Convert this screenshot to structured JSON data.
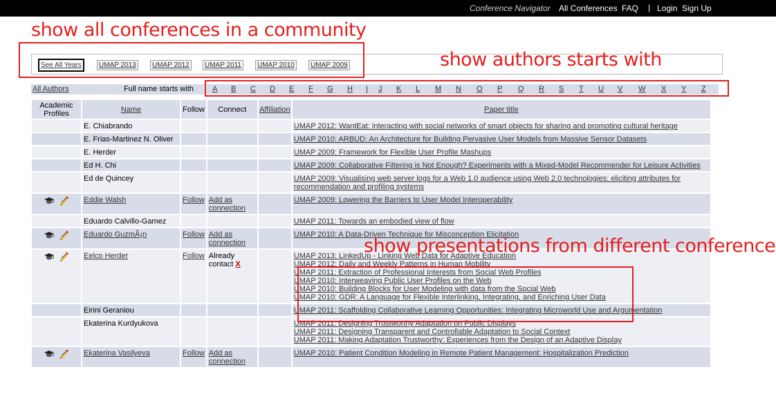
{
  "topbar": {
    "brand": "Conference Navigator",
    "all_conferences": "All Conferences",
    "faq": "FAQ",
    "separator": "|",
    "login": "Login",
    "signup": "Sign Up"
  },
  "year_filter": {
    "items": [
      "See All Years",
      "UMAP 2013",
      "UMAP 2012",
      "UMAP 2011",
      "UMAP 2010",
      "UMAP 2009"
    ]
  },
  "letter_filter": {
    "all_authors": "All Authors",
    "label": "Full name starts with",
    "letters": [
      "A",
      "B",
      "C",
      "D",
      "E",
      "F",
      "G",
      "H",
      "I",
      "J",
      "K",
      "L",
      "M",
      "N",
      "O",
      "P",
      "Q",
      "R",
      "S",
      "T",
      "U",
      "V",
      "W",
      "X",
      "Y",
      "Z"
    ]
  },
  "table": {
    "headers": {
      "profiles": "Academic Profiles",
      "name": "Name",
      "follow": "Follow",
      "connect": "Connect",
      "affiliation": "Affiliation",
      "paper": "Paper title"
    },
    "rows": [
      {
        "name": "E. Chiabrando",
        "papers": [
          "UMAP 2012: WantEat: interacting with social networks of smart objects for sharing and promoting cultural heritage"
        ]
      },
      {
        "name": "E. Frias-Martinez N. Oliver",
        "papers": [
          "UMAP 2010: ARBUD: An Architecture for Building Pervasive User Models from Massive Sensor Datasets"
        ]
      },
      {
        "name": "E. Herder",
        "papers": [
          "UMAP 2009: Framework for Flexible User Profile Mashups"
        ]
      },
      {
        "name": "Ed H. Chi",
        "papers": [
          "UMAP 2009: Collaborative Filtering is Not Enough? Experiments with a Mixed-Model Recommender for Leisure Activities"
        ]
      },
      {
        "name": "Ed de Quincey",
        "papers": [
          "UMAP 2009: Visualising web server logs for a Web 1.0 audience using Web 2.0 technologies: eliciting attributes for recommendation and profiling systems"
        ]
      },
      {
        "name": "Eddie Walsh",
        "follow": "Follow",
        "connect": "Add as connection",
        "papers": [
          "UMAP 2009: Lowering the Barriers to User Model Interoperability"
        ]
      },
      {
        "name": "Eduardo Calvillo-Gamez",
        "papers": [
          "UMAP 2011: Towards an embodied view of flow"
        ]
      },
      {
        "name": "Eduardo GuzmÃ¡n",
        "follow": "Follow",
        "connect": "Add as connection",
        "papers": [
          "UMAP 2010: A Data-Driven Technique for Misconception Elicitation"
        ]
      },
      {
        "name": "Eelco Herder",
        "follow": "Follow",
        "connect": "Already contact",
        "connect_x": "X",
        "papers": [
          "UMAP 2013: LinkedUp - Linking Web Data for Adaptive Education",
          "UMAP 2012: Daily and Weekly Patterns in Human Mobility",
          "UMAP 2011: Extraction of Professional Interests from Social Web Profiles",
          "UMAP 2010: Interweaving Public User Profiles on the Web",
          "UMAP 2010: Building Blocks for User Modeling with data from the Social Web",
          "UMAP 2010: GDR: A Language for Flexible Interlinking, Integrating, and Enriching User Data"
        ]
      },
      {
        "name": "Eirini Geraniou",
        "papers": [
          "UMAP 2011: Scaffolding Collaborative Learning Opportunities: Integrating Microworld Use and Argumentation"
        ]
      },
      {
        "name": "Ekaterina Kurdyukova",
        "papers": [
          "UMAP 2011: Designing Trustworthy Adaptation on Public Displays",
          "UMAP 2011: Designing Transparent and Controllable Adaptation to Social Context",
          "UMAP 2011: Making Adaptation Trustworthy: Experiences from the Design of an Adaptive Display"
        ]
      },
      {
        "name": "Ekaterina Vasilyeva",
        "follow": "Follow",
        "connect": "Add as connection",
        "papers": [
          "UMAP 2010: Patient Condition Modeling in Remote Patient Management: Hospitalization Prediction"
        ]
      }
    ]
  },
  "annotations": {
    "community": "show all conferences in a community",
    "authors": "show authors starts with",
    "presentations": "show presentations from different conferences"
  },
  "colors": {
    "annotation_red": "#e41e1e",
    "cell_bg": "#d7dce8",
    "cell_bg_light": "#eeeff5",
    "topbar_bg": "#000000"
  }
}
